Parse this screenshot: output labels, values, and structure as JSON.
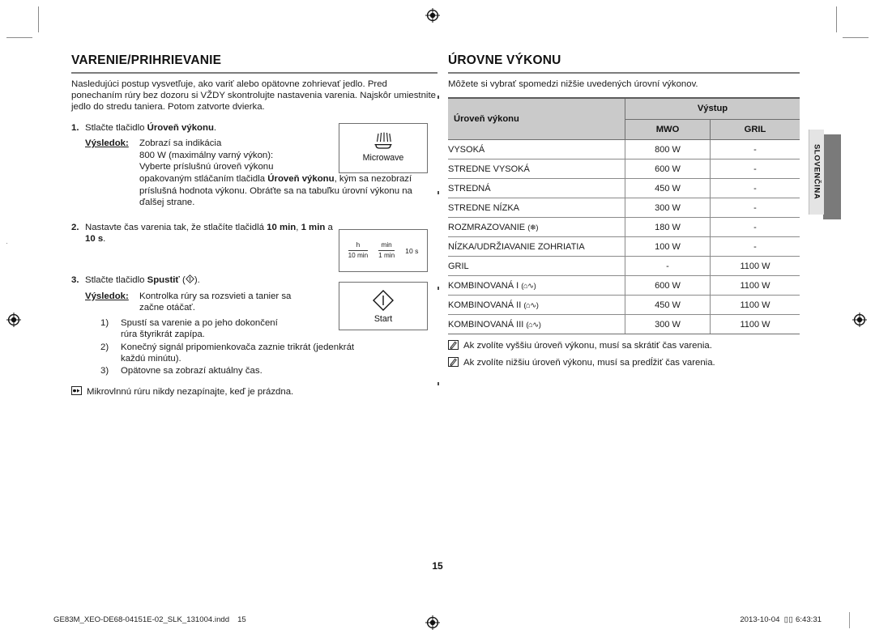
{
  "document": {
    "page_number": "15",
    "language_tab": "SLOVENČINA"
  },
  "left_column": {
    "title": "VARENIE/PRIHRIEVANIE",
    "intro": "Nasledujúci postup vysvetľuje, ako variť alebo opätovne zohrievať jedlo. Pred ponechaním rúry bez dozoru si VŽDY skontrolujte nastavenia varenia. Najskôr umiestnite jedlo do stredu taniera. Potom zatvorte dvierka.",
    "steps": [
      {
        "number": "1.",
        "text_pre": "Stlačte tlačidlo ",
        "text_bold": "Úroveň výkonu",
        "text_post": ".",
        "result_label": "Výsledok:",
        "result_lines": [
          "Zobrazí sa indikácia",
          "800 W (maximálny varný výkon):",
          "Vyberte príslušnú úroveň výkonu"
        ],
        "result_tail_pre": "opakovaným stláčaním tlačidla ",
        "result_tail_bold": "Úroveň výkonu",
        "result_tail_post": ", kým sa nezobrazí príslušná hodnota výkonu. Obráťte sa na tabuľku úrovní výkonu na ďalšej strane."
      },
      {
        "number": "2.",
        "text_pre": "Nastavte čas varenia tak, že stlačíte tlačidlá ",
        "text_bold": "10 min",
        "text_mid": ", ",
        "text_bold2": "1 min",
        "text_mid2": " a ",
        "text_bold3": "10 s",
        "text_post": "."
      },
      {
        "number": "3.",
        "text_pre": "Stlačte tlačidlo ",
        "text_bold": "Spustiť",
        "text_post": " ( ).",
        "result_label": "Výsledok:",
        "result_lines": [
          "Kontrolka rúry sa rozsvieti a tanier sa",
          "začne otáčať."
        ],
        "substeps": [
          {
            "marker": "1)",
            "text": "Spustí sa varenie a po jeho dokončení rúra štyrikrát zapípa."
          },
          {
            "marker": "2)",
            "text": "Konečný signál pripomienkovača zaznie trikrát (jedenkrát každú minútu)."
          },
          {
            "marker": "3)",
            "text": "Opätovne sa zobrazí aktuálny čas."
          }
        ]
      }
    ],
    "warning_note": "Mikrovlnnú rúru nikdy nezapínajte, keď je prázdna.",
    "key_boxes": {
      "microwave": {
        "label": "Microwave",
        "icon": "microwave-icon"
      },
      "time": {
        "keys": [
          {
            "top": "h",
            "bottom": "10 min"
          },
          {
            "top": "min",
            "bottom": "1 min"
          },
          {
            "single": "10 s"
          }
        ]
      },
      "start": {
        "label": "Start",
        "icon": "start-diamond-icon"
      }
    }
  },
  "right_column": {
    "title": "ÚROVNE VÝKONU",
    "intro": "Môžete si vybrať spomedzi nižšie uvedených úrovní výkonov.",
    "table": {
      "header": {
        "level": "Úroveň výkonu",
        "output": "Výstup",
        "mwo": "MWO",
        "gril": "GRIL"
      },
      "rows": [
        {
          "level": "VYSOKÁ",
          "glyph": "",
          "mwo": "800 W",
          "gril": "-"
        },
        {
          "level": "STREDNE VYSOKÁ",
          "glyph": "",
          "mwo": "600 W",
          "gril": "-"
        },
        {
          "level": "STREDNÁ",
          "glyph": "",
          "mwo": "450 W",
          "gril": "-"
        },
        {
          "level": "STREDNE NÍZKA",
          "glyph": "",
          "mwo": "300 W",
          "gril": "-"
        },
        {
          "level": "ROZMRAZOVANIE",
          "glyph": "(❄)",
          "mwo": "180 W",
          "gril": "-"
        },
        {
          "level": "NÍZKA/UDRŽIAVANIE ZOHRIATIA",
          "glyph": "",
          "mwo": "100 W",
          "gril": "-"
        },
        {
          "level": "GRIL",
          "glyph": "",
          "mwo": "-",
          "gril": "1100 W"
        },
        {
          "level": "KOMBINOVANÁ I",
          "glyph": "(⌂∿)",
          "mwo": "600 W",
          "gril": "1100 W"
        },
        {
          "level": "KOMBINOVANÁ II",
          "glyph": "(⌂∿)",
          "mwo": "450 W",
          "gril": "1100 W"
        },
        {
          "level": "KOMBINOVANÁ III",
          "glyph": "(⌂∿)",
          "mwo": "300 W",
          "gril": "1100 W"
        }
      ]
    },
    "notes": [
      "Ak zvolíte vyššiu úroveň výkonu, musí sa skrátiť čas varenia.",
      "Ak zvolíte nižšiu úroveň výkonu, musí sa predĺžiť čas varenia."
    ]
  },
  "footer": {
    "file_name": "GE83M_XEO-DE68-04151E-02_SLK_131004.indd",
    "page": "15",
    "date": "2013-10-04",
    "time_mark": "▯▯",
    "time": "6:43:31"
  }
}
